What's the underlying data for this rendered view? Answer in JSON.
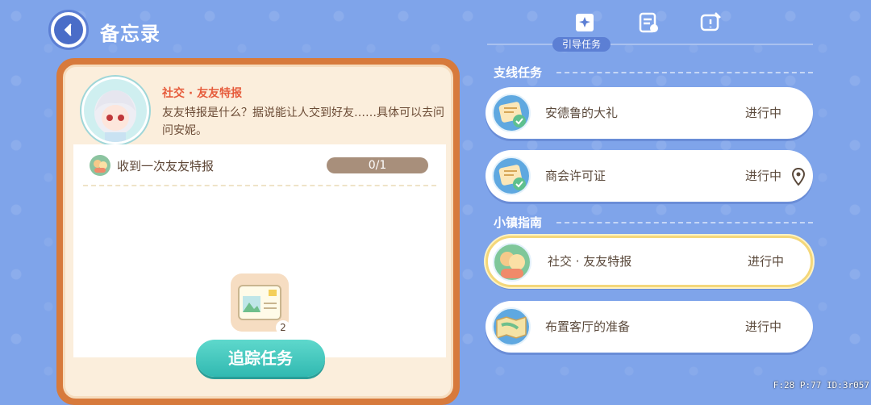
{
  "header": {
    "title": "备忘录"
  },
  "tabs": {
    "active_label": "引导任务",
    "icons": [
      "guide-book-icon",
      "task-list-icon",
      "note-icon"
    ]
  },
  "detail": {
    "quest_name": "社交 · 友友特报",
    "description": "友友特报是什么？据说能让人交到好友……具体可以去问问安妮。",
    "objective": {
      "label": "收到一次友友特报",
      "progress": "0/1"
    },
    "reward": {
      "count": "2",
      "icon": "postcard-icon"
    },
    "track_button": "追踪任务"
  },
  "sections": [
    {
      "title": "支线任务",
      "quests": [
        {
          "name": "安德鲁的大礼",
          "status": "进行中",
          "icon": "scroll-check-icon",
          "pin": false
        },
        {
          "name": "商会许可证",
          "status": "进行中",
          "icon": "scroll-check-icon",
          "pin": true
        }
      ]
    },
    {
      "title": "小镇指南",
      "quests": [
        {
          "name": "社交 · 友友特报",
          "status": "进行中",
          "icon": "friends-icon",
          "pin": false,
          "selected": true
        },
        {
          "name": "布置客厅的准备",
          "status": "进行中",
          "icon": "map-icon",
          "pin": false
        }
      ]
    }
  ],
  "debug": "F:28  P:77  ID:3r057",
  "colors": {
    "background": "#7fa4ea",
    "panel_border": "#d77a3c",
    "track_button": "#31b9b1",
    "quest_name": "#e65b3b"
  }
}
